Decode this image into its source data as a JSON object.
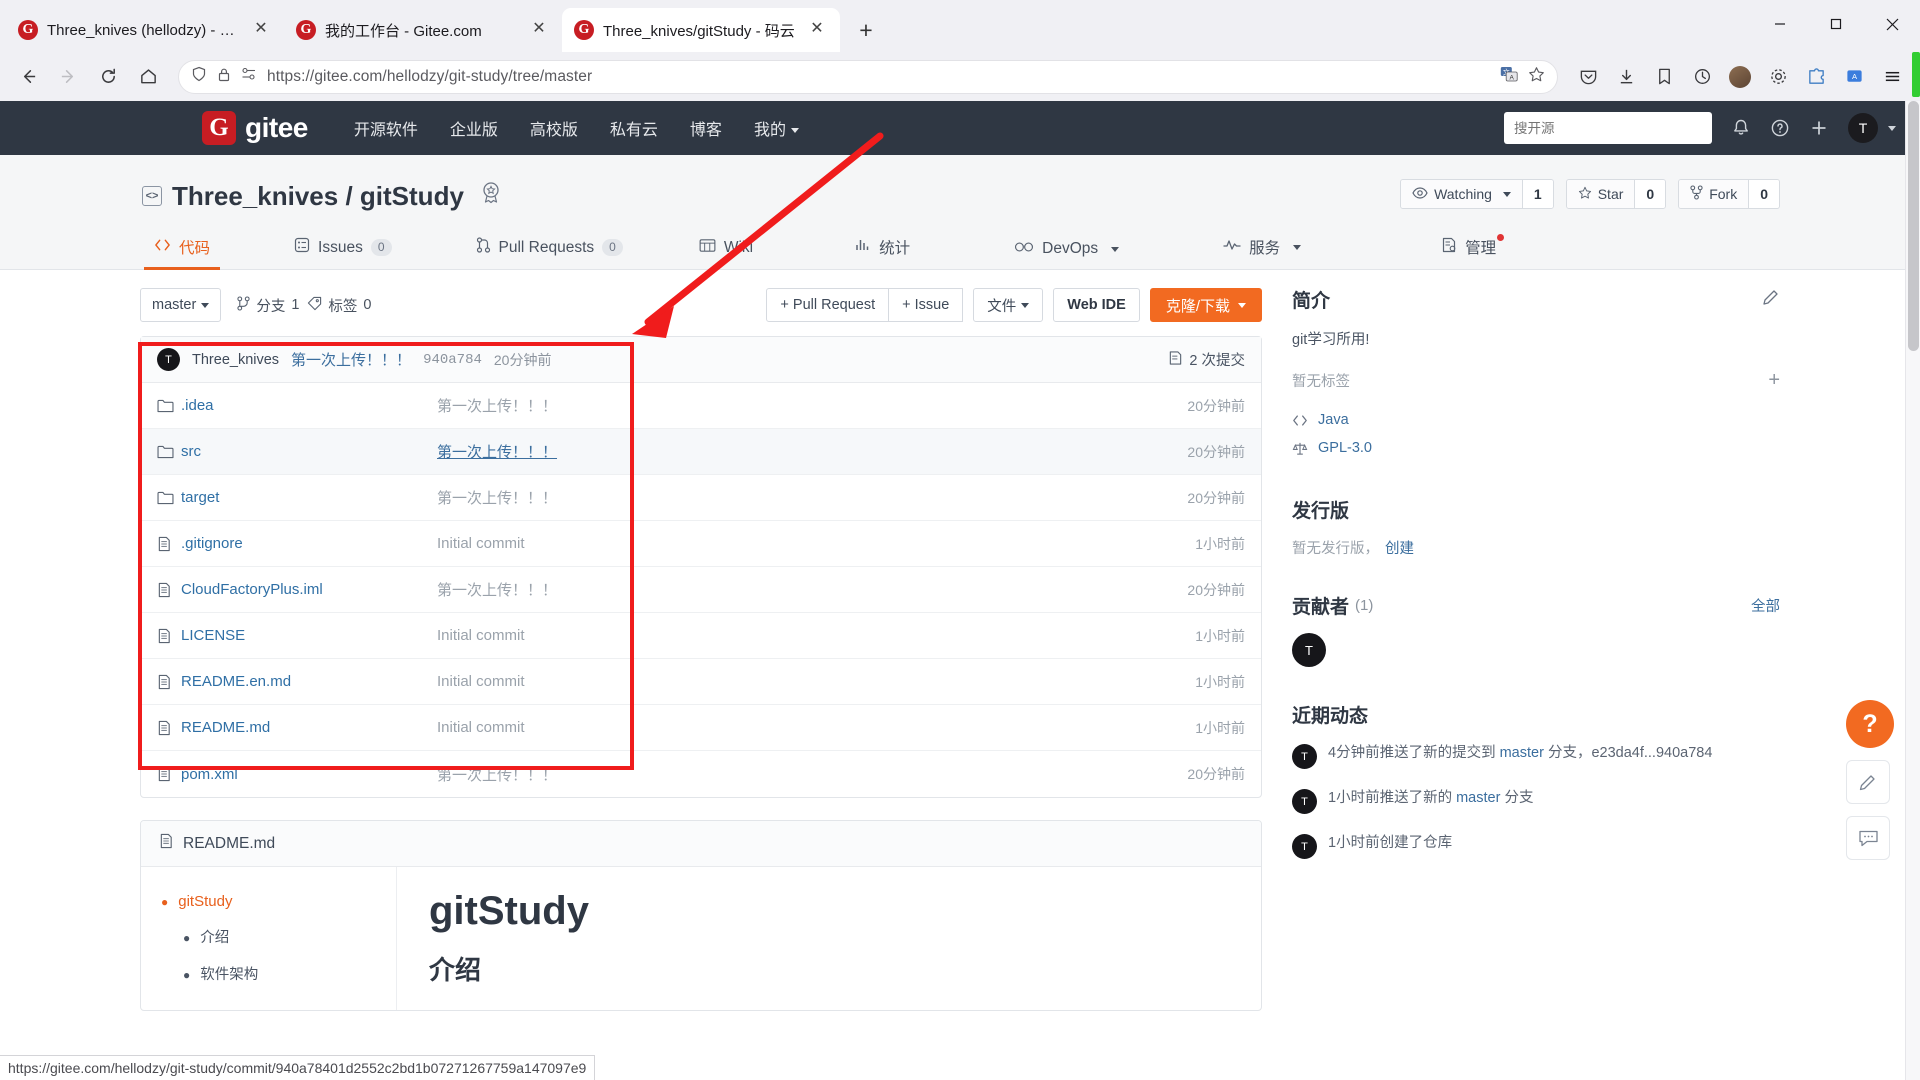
{
  "browser": {
    "tabs": [
      {
        "title": "Three_knives (hellodzy) - Gitee.com",
        "favicon": "gitee-favicon",
        "active": false
      },
      {
        "title": "我的工作台 - Gitee.com",
        "favicon": "gitee-favicon",
        "active": false
      },
      {
        "title": "Three_knives/gitStudy - 码云",
        "favicon": "gitee-favicon",
        "active": true
      }
    ],
    "new_tab_label": "+",
    "window_controls": {
      "minimize": "—",
      "maximize": "▢",
      "close": "✕"
    },
    "url_scheme": "https://",
    "url_host": "gitee.com",
    "url_path": "/hellodzy/git-study/tree/master",
    "url_full": "https://gitee.com/hellodzy/git-study/tree/master",
    "status_bar_url": "https://gitee.com/hellodzy/git-study/commit/940a78401d2552c2bd1b07271267759a147097e9"
  },
  "gitee_header": {
    "brand": "gitee",
    "brand_mark": "G",
    "nav": [
      {
        "label": "开源软件",
        "caret": false
      },
      {
        "label": "企业版",
        "caret": false
      },
      {
        "label": "高校版",
        "caret": false
      },
      {
        "label": "私有云",
        "caret": false
      },
      {
        "label": "博客",
        "caret": false
      },
      {
        "label": "我的",
        "caret": true
      }
    ],
    "search_placeholder": "搜开源",
    "search_value": "",
    "avatar_initial": "T"
  },
  "repo": {
    "owner": "Three_knives",
    "name": "gitStudy",
    "separator": "/",
    "actions": [
      {
        "label": "Watching",
        "count": "1",
        "icon": "eye-icon",
        "caret": true
      },
      {
        "label": "Star",
        "count": "0",
        "icon": "star-icon",
        "caret": false
      },
      {
        "label": "Fork",
        "count": "0",
        "icon": "fork-icon",
        "caret": false
      }
    ],
    "tabs": [
      {
        "label": "代码",
        "icon": "code-icon",
        "count": null,
        "active": true,
        "caret": false,
        "dot": false
      },
      {
        "label": "Issues",
        "icon": "issue-icon",
        "count": "0",
        "active": false,
        "caret": false,
        "dot": false
      },
      {
        "label": "Pull Requests",
        "icon": "pr-icon",
        "count": "0",
        "active": false,
        "caret": false,
        "dot": false
      },
      {
        "label": "Wiki",
        "icon": "wiki-icon",
        "count": null,
        "active": false,
        "caret": false,
        "dot": false
      },
      {
        "label": "统计",
        "icon": "stats-icon",
        "count": null,
        "active": false,
        "caret": false,
        "dot": false
      },
      {
        "label": "DevOps",
        "icon": "devops-icon",
        "count": null,
        "active": false,
        "caret": true,
        "dot": false
      },
      {
        "label": "服务",
        "icon": "service-icon",
        "count": null,
        "active": false,
        "caret": true,
        "dot": false
      },
      {
        "label": "管理",
        "icon": "manage-icon",
        "count": null,
        "active": false,
        "caret": false,
        "dot": true
      }
    ]
  },
  "toolbar": {
    "branch": "master",
    "branches_label": "分支",
    "branches_count": "1",
    "tags_label": "标签",
    "tags_count": "0",
    "pull_request_button": "+ Pull Request",
    "issue_button": "+ Issue",
    "file_button": "文件",
    "web_ide_button": "Web IDE",
    "clone_button": "克隆/下载"
  },
  "commit_bar": {
    "author_initial": "T",
    "author": "Three_knives",
    "message": "第一次上传！！！",
    "sha": "940a784",
    "time": "20分钟前",
    "commits_label": "2 次提交"
  },
  "files": [
    {
      "name": ".idea",
      "type": "folder",
      "message": "第一次上传！！！",
      "time": "20分钟前",
      "hovered": false,
      "message_link": false
    },
    {
      "name": "src",
      "type": "folder",
      "message": "第一次上传！！！",
      "time": "20分钟前",
      "hovered": true,
      "message_link": true
    },
    {
      "name": "target",
      "type": "folder",
      "message": "第一次上传！！！",
      "time": "20分钟前",
      "hovered": false,
      "message_link": false
    },
    {
      "name": ".gitignore",
      "type": "file",
      "message": "Initial commit",
      "time": "1小时前",
      "hovered": false,
      "message_link": false
    },
    {
      "name": "CloudFactoryPlus.iml",
      "type": "file",
      "message": "第一次上传！！！",
      "time": "20分钟前",
      "hovered": false,
      "message_link": false
    },
    {
      "name": "LICENSE",
      "type": "file",
      "message": "Initial commit",
      "time": "1小时前",
      "hovered": false,
      "message_link": false
    },
    {
      "name": "README.en.md",
      "type": "file",
      "message": "Initial commit",
      "time": "1小时前",
      "hovered": false,
      "message_link": false
    },
    {
      "name": "README.md",
      "type": "file",
      "message": "Initial commit",
      "time": "1小时前",
      "hovered": false,
      "message_link": false
    },
    {
      "name": "pom.xml",
      "type": "file",
      "message": "第一次上传！！！",
      "time": "20分钟前",
      "hovered": false,
      "message_link": false
    }
  ],
  "readme": {
    "filename": "README.md",
    "toc": [
      {
        "label": "gitStudy",
        "level": 1
      },
      {
        "label": "介绍",
        "level": 2
      },
      {
        "label": "软件架构",
        "level": 2
      }
    ],
    "heading": "gitStudy",
    "subheading": "介绍"
  },
  "sidebar": {
    "about": {
      "title": "简介",
      "edit_icon": "pencil-icon",
      "description": "git学习所用!",
      "no_tags": "暂无标签",
      "add_tag": "+",
      "language": "Java",
      "license": "GPL-3.0"
    },
    "releases": {
      "title": "发行版",
      "empty_text": "暂无发行版，",
      "create_link": "创建"
    },
    "contributors": {
      "title": "贡献者",
      "count": "(1)",
      "all_link": "全部",
      "avatars": [
        "T"
      ]
    },
    "activity": {
      "title": "近期动态",
      "items": [
        {
          "avatar": "T",
          "prefix": "4分钟前推送了新的提交到 ",
          "link": "master",
          "suffix": " 分支，e23da4f...940a784"
        },
        {
          "avatar": "T",
          "prefix": "1小时前推送了新的 ",
          "link": "master",
          "suffix": " 分支"
        },
        {
          "avatar": "T",
          "prefix": "1小时前创建了仓库",
          "link": "",
          "suffix": ""
        }
      ]
    }
  },
  "float_buttons": [
    {
      "name": "help-button",
      "glyph": "?"
    },
    {
      "name": "feedback-edit-button",
      "glyph": "✎"
    },
    {
      "name": "chat-button",
      "glyph": "💬"
    }
  ],
  "colors": {
    "gitee_red": "#c71d23",
    "accent_orange": "#f26a21",
    "header_dark": "#2f3743",
    "annotation_red": "#f01c1c",
    "link_blue": "#3b6e9e"
  }
}
